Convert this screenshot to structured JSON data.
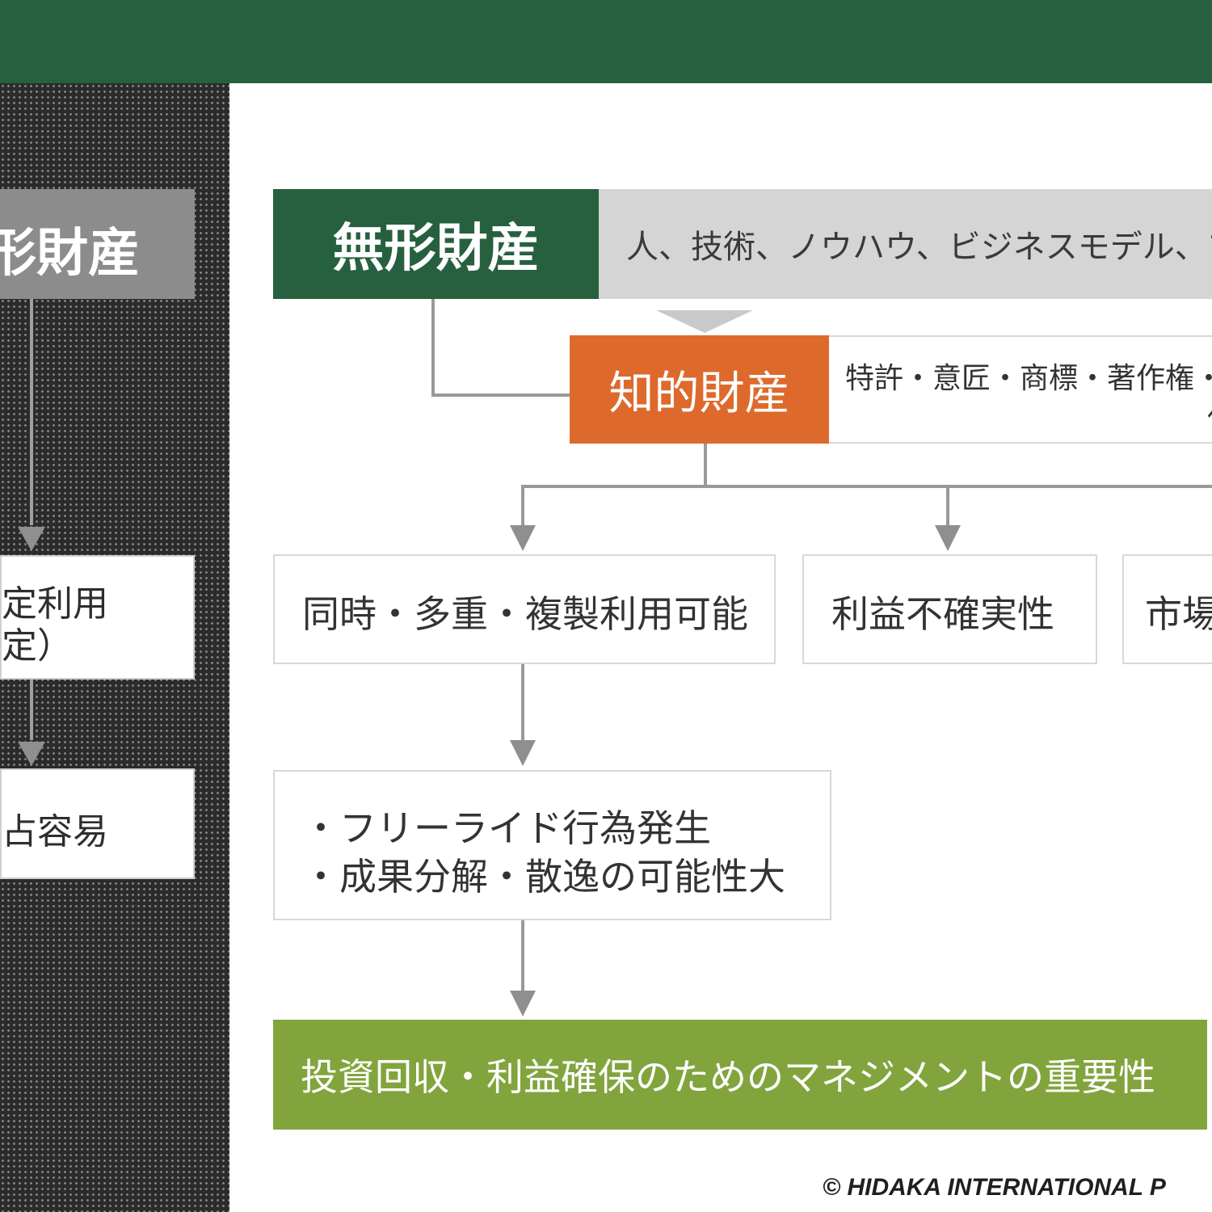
{
  "colors": {
    "header_bar": "#27603f",
    "intangible": "#27603f",
    "intellectual_property": "#dd6a2c",
    "conclusion": "#82a43d",
    "connector": "#8f8f8f"
  },
  "left_panel": {
    "title": "形財産",
    "box1_line1": "定利用",
    "box1_line2": "定）",
    "box2": "占容易"
  },
  "intangible": {
    "label": "無形財産",
    "description": "人、技術、ノウハウ、ビジネスモデル、ブラ"
  },
  "intellectual_property": {
    "label": "知的財産",
    "description_line1": "特許・意匠・商標・著作権・",
    "description_line2": "保"
  },
  "characteristics": [
    "同時・多重・複製利用可能",
    "利益不確実性",
    "市場"
  ],
  "consequences": {
    "line1": "・フリーライド行為発生",
    "line2": "・成果分解・散逸の可能性大"
  },
  "conclusion": "投資回収・利益確保のためのマネジメントの重要性",
  "copyright": "© HIDAKA INTERNATIONAL P"
}
